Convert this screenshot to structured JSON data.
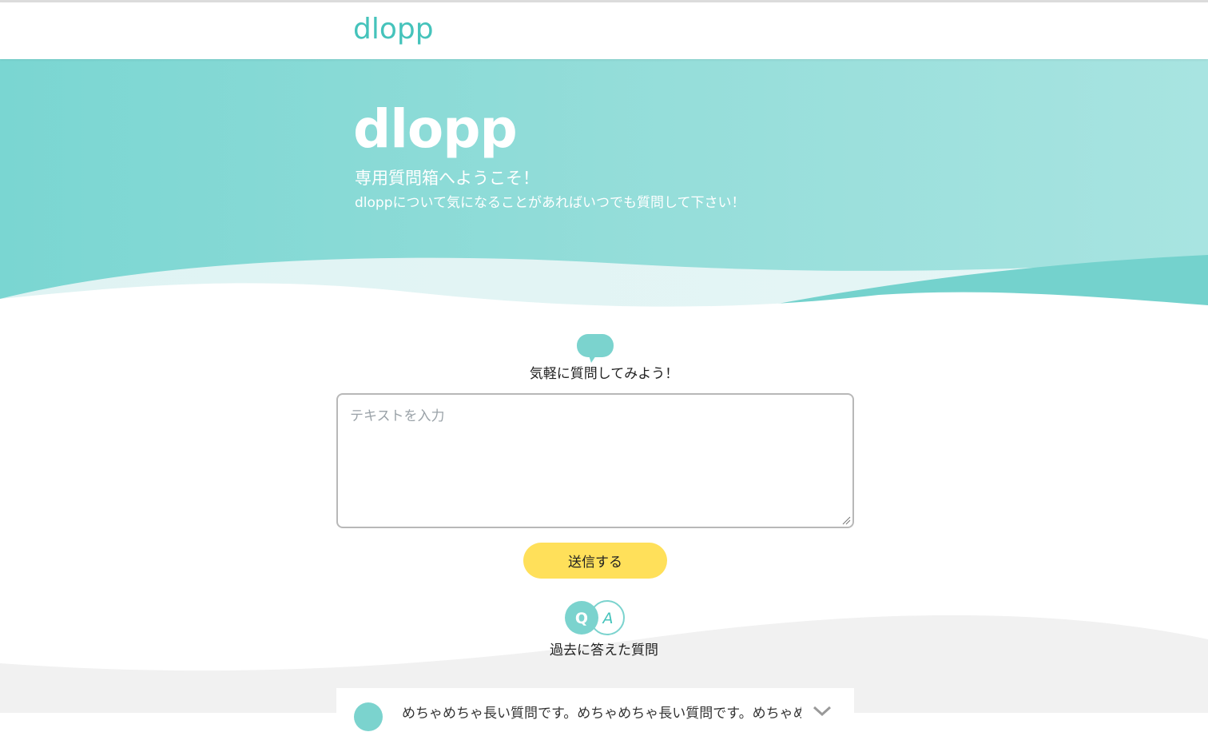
{
  "navbar": {
    "logo": "dlopp"
  },
  "hero": {
    "logo": "dlopp",
    "title": "専用質問箱へようこそ！",
    "subtitle": "dloppについて気になることがあればいつでも質問して下さい！"
  },
  "ask": {
    "prompt": "気軽に質問してみよう！",
    "placeholder": "テキストを入力",
    "value": "",
    "send_label": "送信する"
  },
  "past": {
    "title": "過去に答えた質問",
    "qa_icon_q": "Q",
    "qa_icon_a": "A",
    "items": [
      {
        "text": "めちゃめちゃ長い質問です。めちゃめちゃ長い質問です。めちゃめちゃ長い質問です。"
      }
    ]
  },
  "colors": {
    "brand": "#45c3bb",
    "hero_bg": "#7ad6d2",
    "send_button": "#ffe05a",
    "grey_section": "#f1f1f1"
  },
  "icons": [
    "speech-bubble-icon",
    "qa-badge-icon",
    "q-icon",
    "chevron-down-icon"
  ]
}
